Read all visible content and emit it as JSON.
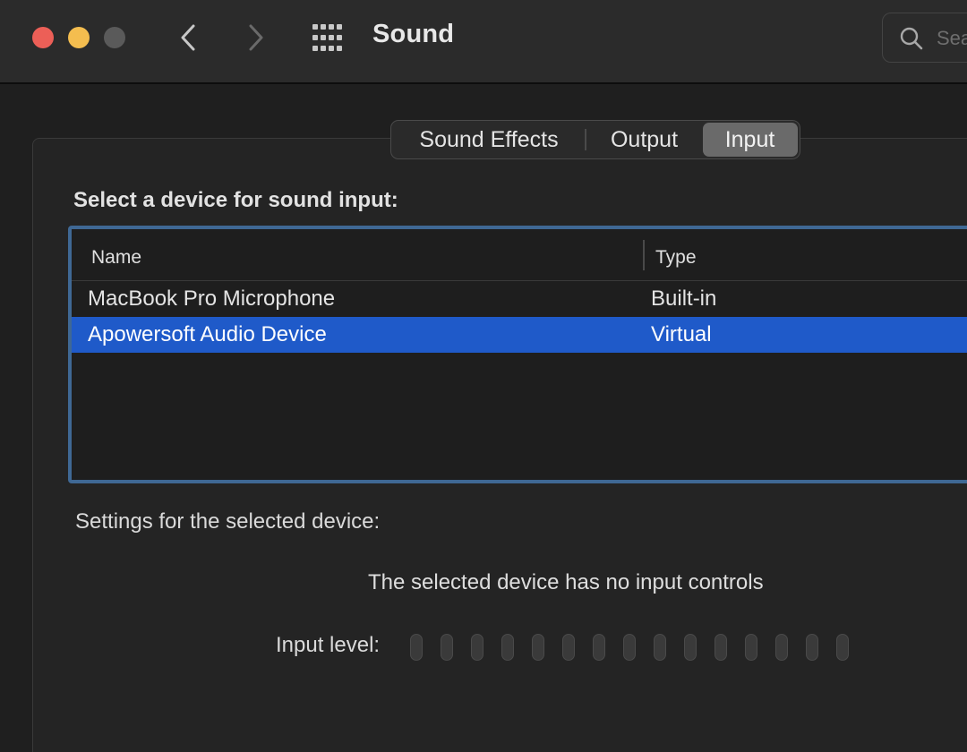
{
  "window": {
    "title": "Sound",
    "search_placeholder": "Search"
  },
  "tabs": [
    {
      "label": "Sound Effects",
      "selected": false
    },
    {
      "label": "Output",
      "selected": false
    },
    {
      "label": "Input",
      "selected": true
    }
  ],
  "input": {
    "section_label": "Select a device for sound input:",
    "columns": {
      "name": "Name",
      "type": "Type"
    },
    "devices": [
      {
        "name": "MacBook Pro Microphone",
        "type": "Built-in",
        "selected": false
      },
      {
        "name": "Apowersoft Audio Device",
        "type": "Virtual",
        "selected": true
      }
    ],
    "settings_label": "Settings for the selected device:",
    "no_controls_message": "The selected device has no input controls",
    "level_label": "Input level:",
    "level_segments_total": 15,
    "level_segments_lit": 0
  },
  "colors": {
    "accent_selection": "#1f5ac9",
    "table_focus_ring": "#3f6894",
    "close": "#ec5f57",
    "minimize": "#f4bd4f",
    "zoom_disabled": "#5a5a5a"
  },
  "icons": {
    "back": "chevron-left-icon",
    "forward": "chevron-right-icon",
    "show_all": "grid-icon",
    "search": "search-icon"
  }
}
